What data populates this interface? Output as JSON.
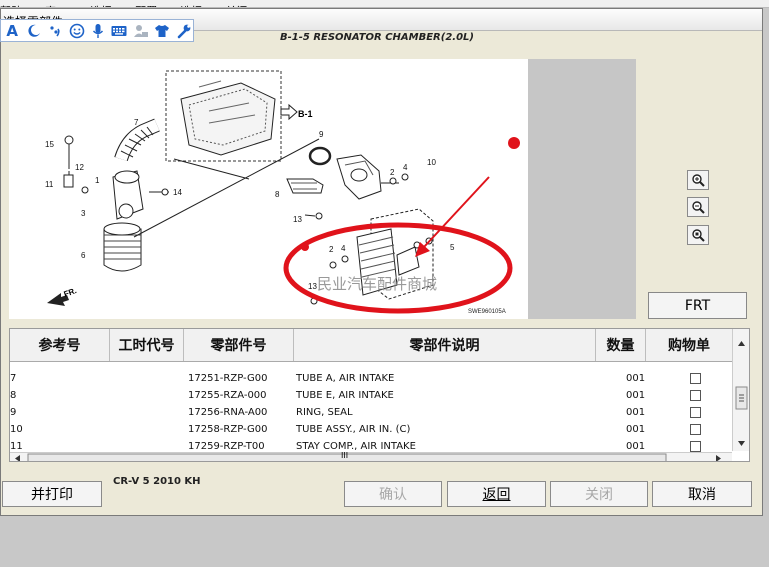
{
  "menubar": {
    "items": [
      "帮助",
      "窗口",
      "选择",
      "配置",
      "选择",
      "关闭"
    ]
  },
  "window": {
    "title": "选择零部件"
  },
  "ime_toolbar": {
    "icons": [
      "letter-a-icon",
      "moon-icon",
      "dots-icon",
      "smiley-icon",
      "microphone-icon",
      "keyboard-icon",
      "user-icon",
      "shirt-icon",
      "wrench-icon"
    ],
    "letter": "A"
  },
  "diagram": {
    "title": "B-1-5 RESONATOR CHAMBER(2.0L)",
    "ref_b1": "B-1",
    "code": "SWE960105A",
    "watermark": "民业汽车配件商城",
    "fr_label": "FR.",
    "callouts": [
      "15",
      "12",
      "11",
      "1",
      "3",
      "6",
      "7",
      "14",
      "9",
      "10",
      "8",
      "2",
      "4",
      "13",
      "5",
      "2",
      "4",
      "13"
    ]
  },
  "zoom_buttons": [
    "zoom-in-icon",
    "zoom-out-icon",
    "zoom-fit-icon"
  ],
  "frt_button": "FRT",
  "table": {
    "columns": [
      "参考号",
      "工时代号",
      "零部件号",
      "零部件说明",
      "数量",
      "购物单"
    ],
    "rows": [
      {
        "ref": "7",
        "labor": "",
        "part": "17251-RZP-G00",
        "desc": "TUBE A, AIR INTAKE",
        "qty": "001",
        "checked": false
      },
      {
        "ref": "8",
        "labor": "",
        "part": "17255-RZA-000",
        "desc": "TUBE E, AIR INTAKE",
        "qty": "001",
        "checked": false
      },
      {
        "ref": "9",
        "labor": "",
        "part": "17256-RNA-A00",
        "desc": "RING, SEAL",
        "qty": "001",
        "checked": false
      },
      {
        "ref": "10",
        "labor": "",
        "part": "17258-RZP-G00",
        "desc": "TUBE ASSY., AIR IN. (C)",
        "qty": "001",
        "checked": false
      },
      {
        "ref": "11",
        "labor": "",
        "part": "17259-RZP-T00",
        "desc": "STAY COMP., AIR INTAKE",
        "qty": "001",
        "checked": false
      }
    ],
    "hscroll_grip": "III"
  },
  "footer": {
    "print_button": "并打印",
    "vehicle": "CR-V  5  2010  KH",
    "confirm_button": "确认",
    "back_button": "返回",
    "close_button": "关闭",
    "cancel_button": "取消"
  },
  "colors": {
    "accent_red": "#e0131b",
    "ime_blue": "#1e63c8"
  }
}
